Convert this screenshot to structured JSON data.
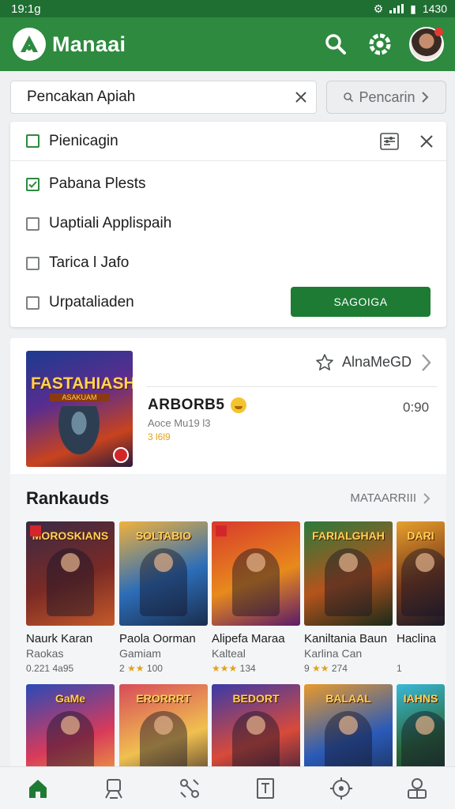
{
  "status_bar": {
    "time": "19:1g",
    "right_text": "1430"
  },
  "app_bar": {
    "title": "Manaai"
  },
  "search": {
    "value": "Pencakan Apiah",
    "button_label": "Pencarin"
  },
  "filter": {
    "title": "Pienicagin",
    "items": [
      {
        "label": "Pabana Plests",
        "checked": true
      },
      {
        "label": "Uaptiali Applispaih",
        "checked": false
      },
      {
        "label": "Tarica l Jafo",
        "checked": false
      },
      {
        "label": "Urpataliaden",
        "checked": false
      }
    ],
    "apply_label": "SAGOIGA"
  },
  "featured": {
    "thumb_title": "FASTAHIASH",
    "thumb_subtitle": "ASAKUAM",
    "action_label": "AlnaMeGD",
    "name": "ARBORB5",
    "developer": "Aoce Mu19 l3",
    "rating": "3 l6l9",
    "time": "0:90"
  },
  "rankings": {
    "title": "Rankauds",
    "more_label": "MATAARRIII",
    "row1": [
      {
        "art_title": "MOROSKIANS",
        "name": "Naurk Karan",
        "dev": "Raokas",
        "rating": "0.221 4a95",
        "colors": [
          "#3a2a45",
          "#7a2a25",
          "#c45a2a"
        ]
      },
      {
        "art_title": "SOLTABIO",
        "name": "Paola Oorman",
        "dev": "Gamiam",
        "rating": "2 ★★ 100",
        "colors": [
          "#f0b23c",
          "#2c6db8",
          "#1a2d4c"
        ]
      },
      {
        "art_title": "",
        "name": "Alipefa Maraa",
        "dev": "Kalteal",
        "rating": "★★★ 134",
        "colors": [
          "#d83a2c",
          "#e88a1c",
          "#5a1a6a"
        ]
      },
      {
        "art_title": "FARIALGHAH",
        "name": "Kaniltania Baun",
        "dev": "Karlina Can",
        "rating": "9 ★★ 274",
        "colors": [
          "#2a7a3c",
          "#b4541c",
          "#1a2a1a"
        ]
      },
      {
        "art_title": "DARI",
        "name": "Haclina",
        "dev": "",
        "rating": "1",
        "colors": [
          "#e8a02c",
          "#7a3a1a",
          "#1a1a2a"
        ]
      }
    ],
    "row2": [
      {
        "art_title": "GaMe",
        "colors": [
          "#2a4ab8",
          "#d83a5a",
          "#f0b23c"
        ]
      },
      {
        "art_title": "ERORRRT",
        "colors": [
          "#d84a5a",
          "#f0c050",
          "#3a2a2a"
        ]
      },
      {
        "art_title": "BEDORT",
        "colors": [
          "#3a3aa8",
          "#d84a3a",
          "#1a1a3a"
        ]
      },
      {
        "art_title": "BALAAL",
        "colors": [
          "#e89a2c",
          "#2a5ab8",
          "#1a2a4a"
        ]
      },
      {
        "art_title": "IAHNS",
        "colors": [
          "#3ab8d8",
          "#2a6a3a",
          "#1a2a2a"
        ]
      }
    ]
  },
  "colors": {
    "primary": "#2d8a3f",
    "primary_dark": "#1f6e32",
    "apply": "#1e7b34",
    "star": "#e3a21a"
  },
  "bottom_nav": {
    "icons": [
      "home-icon",
      "person-icon",
      "compare-icon",
      "book-icon",
      "gamepad-icon",
      "profile-icon"
    ]
  }
}
